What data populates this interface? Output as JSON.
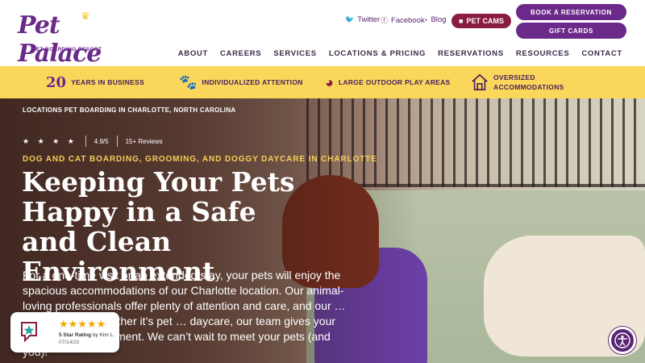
{
  "logo": {
    "wordmark": "Pet Palace",
    "tagline": "PET BOARDING RESORT"
  },
  "header": {
    "social": [
      {
        "icon": "twitter-icon",
        "label": "Twitter"
      },
      {
        "icon": "facebook-icon",
        "label": "Facebook"
      },
      {
        "icon": "rss-icon",
        "label": "Blog"
      }
    ],
    "pet_cams_label": "PET CAMS",
    "book_label": "BOOK A RESERVATION",
    "gift_label": "GIFT CARDS"
  },
  "nav": [
    "ABOUT",
    "CAREERS",
    "SERVICES",
    "LOCATIONS & PRICING",
    "RESERVATIONS",
    "RESOURCES",
    "CONTACT"
  ],
  "features": [
    {
      "num": "20",
      "text": "YEARS IN BUSINESS"
    },
    {
      "icon": "paw-icon",
      "text": "INDIVIDUALIZED ATTENTION"
    },
    {
      "icon": "ball-icon",
      "text": "LARGE OUTDOOR PLAY AREAS"
    },
    {
      "icon": "house-icon",
      "text": "OVERSIZED ACCOMMODATIONS"
    }
  ],
  "hero": {
    "breadcrumb": "LOCATIONS PET BOARDING IN CHARLOTTE, NORTH CAROLINA",
    "stars": "★ ★ ★ ★",
    "score": "4.9/5",
    "reviews": "15+ Reviews",
    "eyebrow": "DOG AND CAT BOARDING, GROOMING, AND DOGGY DAYCARE IN CHARLOTTE",
    "headline": "Keeping Your Pets Happy in a Safe and Clean Environment",
    "body": "For a one-time visit or an extended stay, your pets will enjoy the spacious accommodations of our Charlotte location. Our animal-loving professionals offer plenty of attention and care, and our … taken care of. Whether it’s pet … daycare, our team gives your pets the royal treatment. We can’t wait to meet your pets (and you)!"
  },
  "review_widget": {
    "stars": "★★★★★",
    "rating_text": "5 Star Rating",
    "by_text": "by Kim L.",
    "date": "07/14/23"
  },
  "colors": {
    "purple": "#6b2a8a",
    "maroon": "#8a1c3f",
    "yellow": "#fad75a",
    "gold": "#f6cf57"
  }
}
